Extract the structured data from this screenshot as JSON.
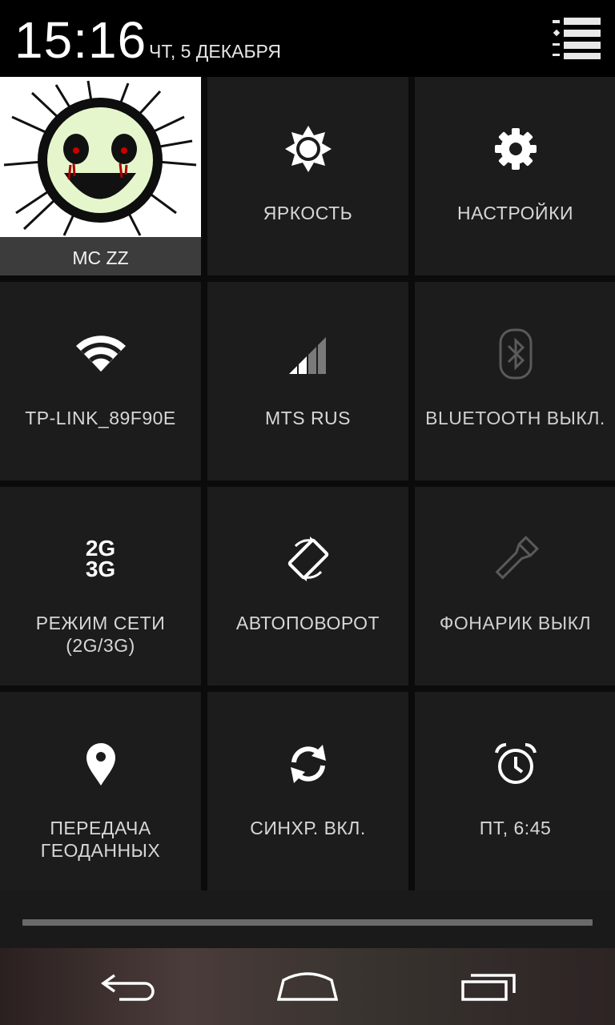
{
  "status": {
    "time": "15:16",
    "date": "ЧТ, 5 ДЕКАБРЯ"
  },
  "header": {
    "list_icon": "notification-list-icon"
  },
  "tiles": {
    "user": {
      "label": "MC ZZ",
      "icon": "avatar"
    },
    "brightness": {
      "label": "ЯРКОСТЬ",
      "icon": "brightness-icon"
    },
    "settings": {
      "label": "НАСТРОЙКИ",
      "icon": "gear-icon"
    },
    "wifi": {
      "label": "TP-LINK_89F90E",
      "icon": "wifi-icon"
    },
    "mobile": {
      "label": "MTS RUS",
      "icon": "signal-icon"
    },
    "bluetooth": {
      "label": "BLUETOOTH ВЫКЛ.",
      "icon": "bluetooth-icon"
    },
    "network_mode": {
      "label_line1": "РЕЖИМ СЕТИ",
      "label_line2": "(2G/3G)",
      "icon_top": "2G",
      "icon_bottom": "3G"
    },
    "autorotate": {
      "label": "АВТОПОВОРОТ",
      "icon": "rotate-icon"
    },
    "flashlight": {
      "label": "ФОНАРИК ВЫКЛ",
      "icon": "flashlight-icon"
    },
    "location": {
      "label_line1": "ПЕРЕДАЧА",
      "label_line2": "ГЕОДАННЫХ",
      "icon": "location-pin-icon"
    },
    "sync": {
      "label": "СИНХР. ВКЛ.",
      "icon": "sync-icon"
    },
    "alarm": {
      "label": "ПТ, 6:45",
      "icon": "alarm-clock-icon"
    }
  },
  "navbar": {
    "back": "back-icon",
    "home": "home-icon",
    "recents": "recents-icon"
  },
  "colors": {
    "tile_bg": "#1c1c1c",
    "grid_gap": "#0b0b0b",
    "icon_on": "#ffffff",
    "icon_off": "#5a5a5a"
  }
}
